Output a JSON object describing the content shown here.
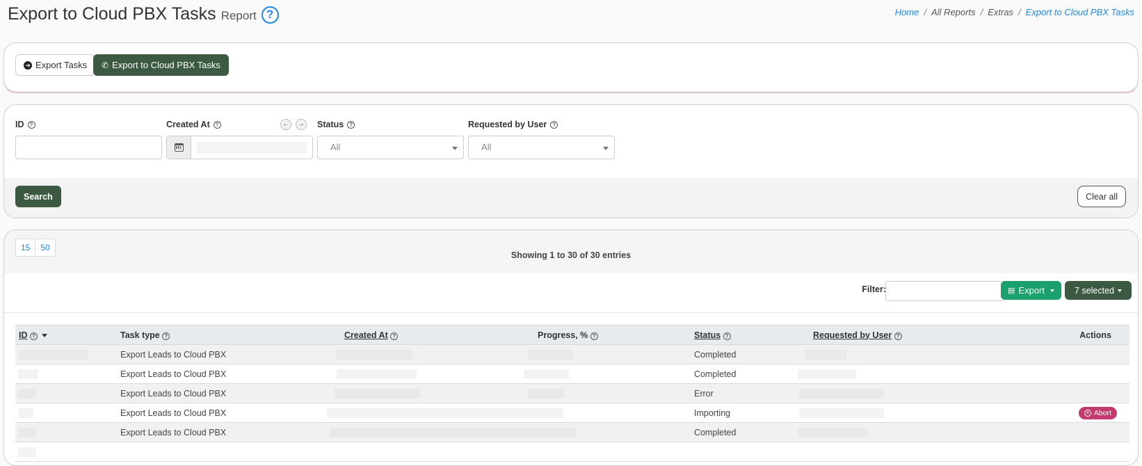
{
  "header": {
    "title": "Export to Cloud PBX Tasks",
    "subtitle": "Report",
    "help_glyph": "?"
  },
  "breadcrumb": {
    "items": [
      "Home",
      "All Reports",
      "Extras",
      "Export to Cloud PBX Tasks"
    ],
    "separator": "/"
  },
  "tabs": {
    "export_tasks": "Export Tasks",
    "export_cloud_pbx": "Export to Cloud PBX Tasks"
  },
  "filters": {
    "id_label": "ID",
    "created_at_label": "Created At",
    "status_label": "Status",
    "status_value": "All",
    "requested_by_label": "Requested by User",
    "requested_by_value": "All",
    "search_button": "Search",
    "clear_button": "Clear all"
  },
  "table_controls": {
    "page_sizes": [
      "15",
      "50"
    ],
    "showing": "Showing 1 to 30 of 30 entries",
    "filter_label": "Filter:",
    "export_button": "Export",
    "columns_button": "7 selected"
  },
  "table": {
    "columns": [
      "ID",
      "Task type",
      "Created At",
      "Progress, %",
      "Status",
      "Requested by User",
      "Actions"
    ],
    "rows": [
      {
        "task_type": "Export Leads to Cloud PBX",
        "status": "Completed",
        "action": ""
      },
      {
        "task_type": "Export Leads to Cloud PBX",
        "status": "Completed",
        "action": ""
      },
      {
        "task_type": "Export Leads to Cloud PBX",
        "status": "Error",
        "action": ""
      },
      {
        "task_type": "Export Leads to Cloud PBX",
        "status": "Importing",
        "action": "Abort"
      },
      {
        "task_type": "Export Leads to Cloud PBX",
        "status": "Completed",
        "action": ""
      }
    ]
  },
  "colors": {
    "accent_dark": "#3c5a42",
    "export_green": "#1aa06d",
    "link_blue": "#1e88e5",
    "abort": "#c23a6e"
  }
}
